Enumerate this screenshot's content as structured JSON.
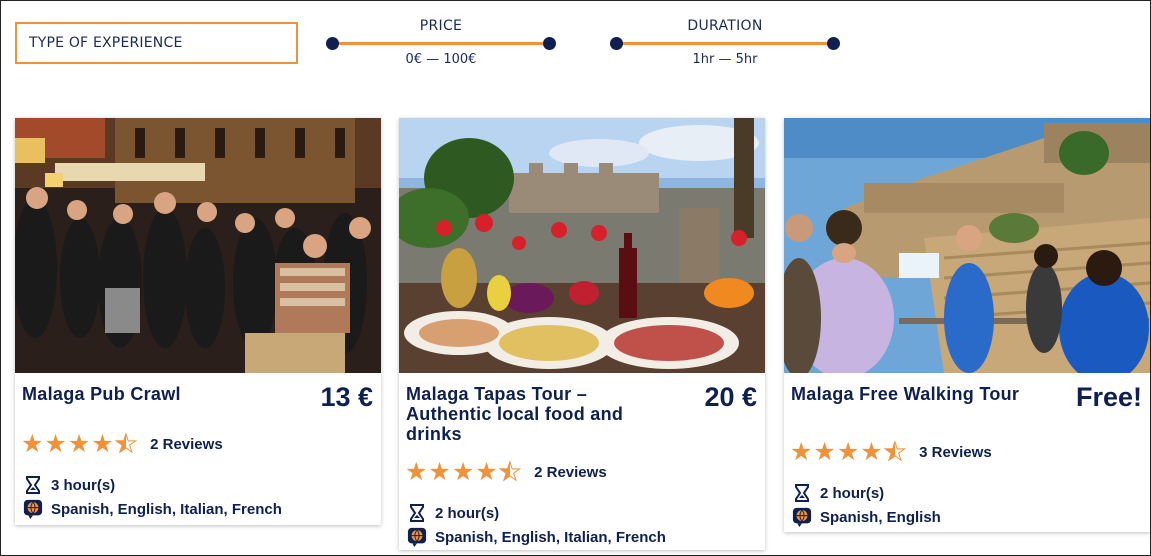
{
  "filters": {
    "type_label": "TYPE OF EXPERIENCE",
    "price": {
      "label": "PRICE",
      "value": "0€ — 100€"
    },
    "duration": {
      "label": "DURATION",
      "value": "1hr — 5hr"
    }
  },
  "colors": {
    "accent": "#f0923a",
    "navy": "#0f2050"
  },
  "tours": [
    {
      "title": "Malaga Pub Crawl",
      "price": "13 €",
      "rating": 4.5,
      "reviews": "2 Reviews",
      "duration": "3 hour(s)",
      "languages": "Spanish, English, Italian, French"
    },
    {
      "title": "Malaga Tapas Tour – Authentic local food and drinks",
      "price": "20 €",
      "rating": 4.5,
      "reviews": "2 Reviews",
      "duration": "2 hour(s)",
      "languages": "Spanish, English, Italian, French"
    },
    {
      "title": "Malaga Free Walking Tour",
      "price": "Free!",
      "rating": 4.5,
      "reviews": "3 Reviews",
      "duration": "2 hour(s)",
      "languages": "Spanish, English"
    }
  ],
  "icons": {
    "duration": "hourglass-icon",
    "languages": "speech-globe-icon",
    "rating": "star-icon"
  }
}
